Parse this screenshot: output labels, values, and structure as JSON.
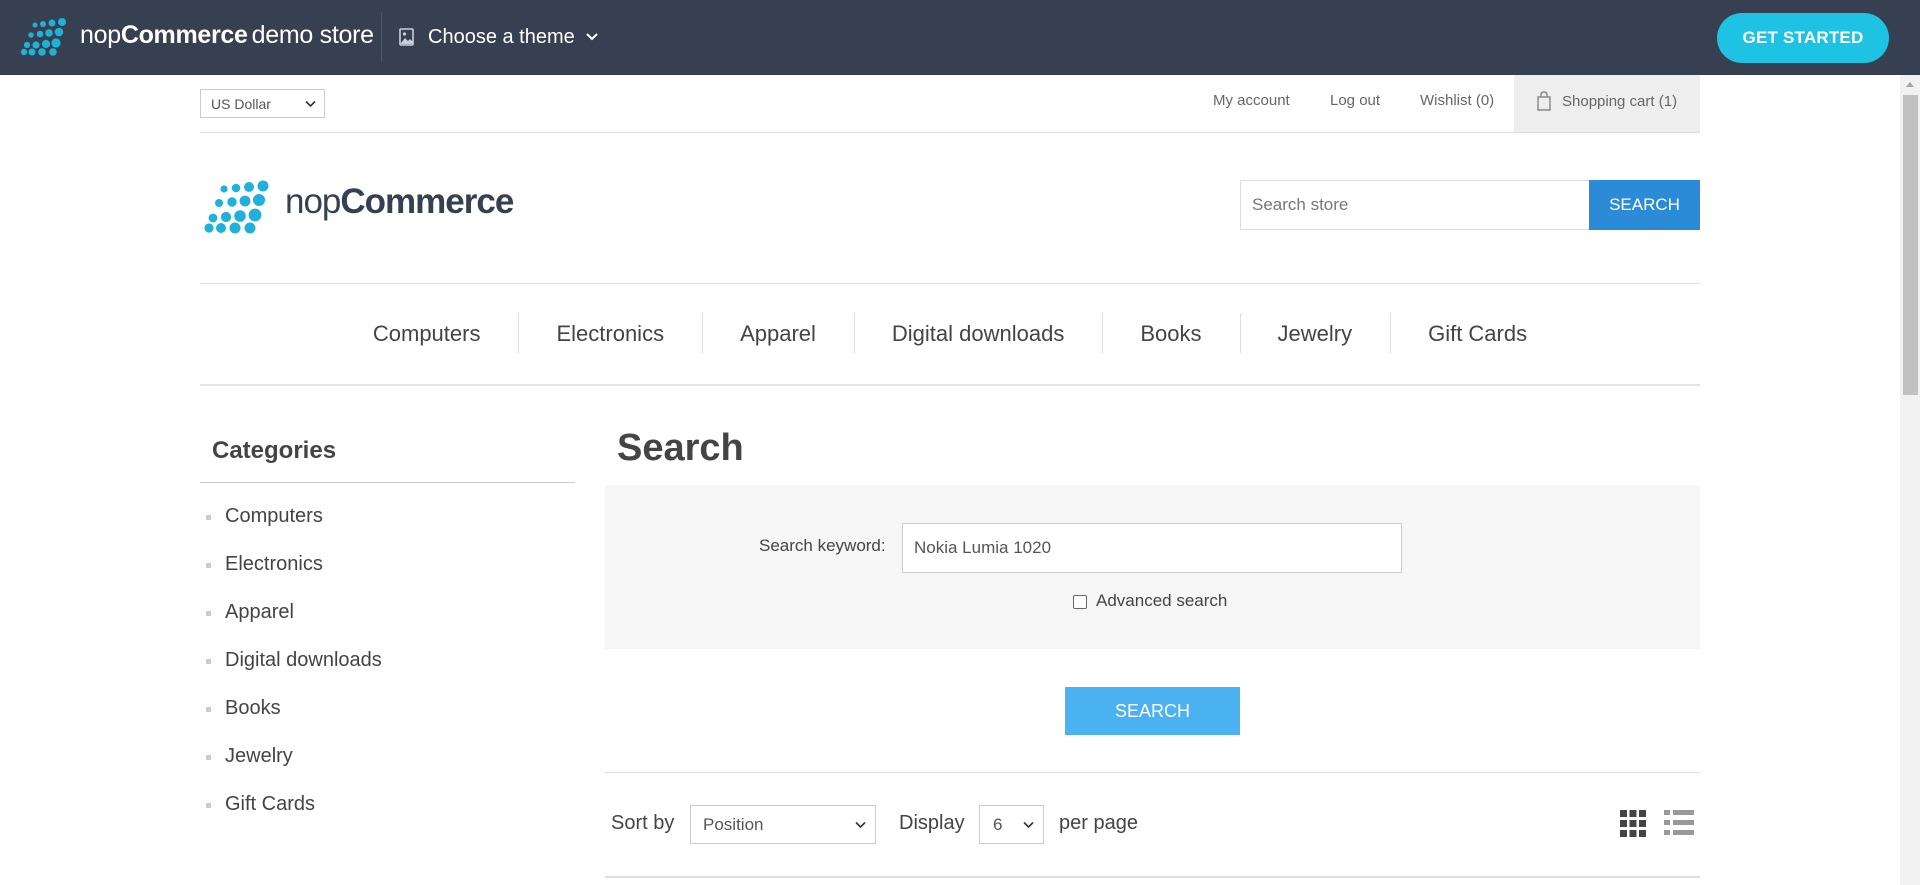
{
  "demobar": {
    "brand_thin": "nop",
    "brand_bold": "Commerce",
    "brand_suffix": "demo store",
    "theme_label": "Choose a theme",
    "get_started": "GET STARTED"
  },
  "header": {
    "currency": "US Dollar",
    "links": {
      "my_account": "My account",
      "log_out": "Log out",
      "wishlist": "Wishlist (0)",
      "cart": "Shopping cart (1)"
    },
    "logo_thin": "nop",
    "logo_bold": "Commerce",
    "search_placeholder": "Search store",
    "search_button": "SEARCH"
  },
  "menu": {
    "items": [
      "Computers",
      "Electronics",
      "Apparel",
      "Digital downloads",
      "Books",
      "Jewelry",
      "Gift Cards"
    ]
  },
  "sidebar": {
    "title": "Categories",
    "items": [
      "Computers",
      "Electronics",
      "Apparel",
      "Digital downloads",
      "Books",
      "Jewelry",
      "Gift Cards"
    ]
  },
  "search_page": {
    "title": "Search",
    "keyword_label": "Search keyword:",
    "keyword_value": "Nokia Lumia 1020",
    "advanced_label": "Advanced search",
    "advanced_checked": false,
    "search_button": "SEARCH",
    "sort_label": "Sort by",
    "sort_value": "Position",
    "display_label": "Display",
    "page_size": "6",
    "per_page_label": "per page"
  },
  "icons": {
    "logo": "dots-logo-icon",
    "theme": "image-icon",
    "chevron": "chevron-down-icon",
    "cart": "shopping-bag-icon",
    "grid_view": "grid-view-icon",
    "list_view": "list-view-icon"
  },
  "colors": {
    "demobar_bg": "#374050",
    "accent_cyan": "#1ec2e2",
    "search_button": "#2c8bd6",
    "primary_button": "#4ab2f1",
    "logo_dots": "#1fb1d9"
  }
}
